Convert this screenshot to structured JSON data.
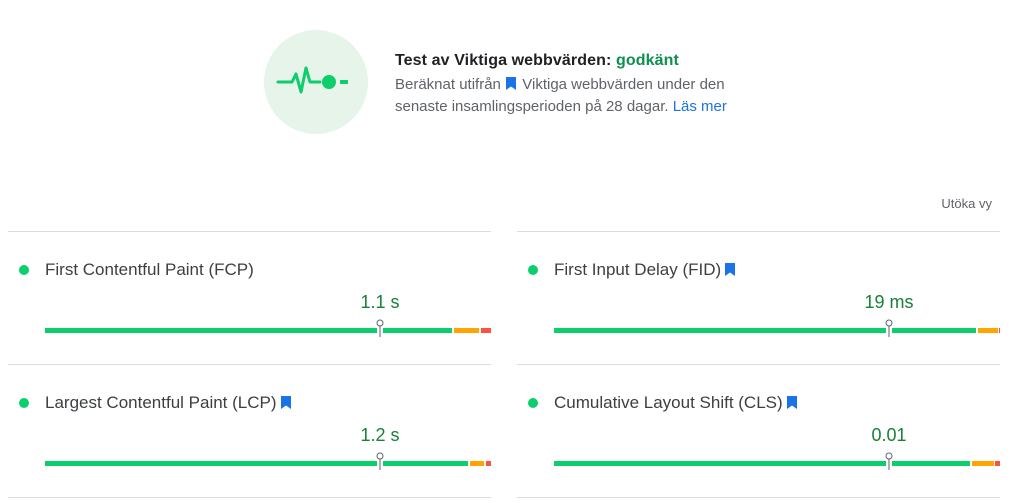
{
  "summary": {
    "title_prefix": "Test av Viktiga webbvärden:",
    "title_status": "godkänt",
    "desc_part1": "Beräknat utifrån",
    "desc_part2": "Viktiga webbvärden under den senaste insamlingsperioden på 28 dagar.",
    "learn_more": "Läs mer"
  },
  "expand_label": "Utöka vy",
  "colors": {
    "good": "#0cce6b",
    "needs_improvement": "#ffa400",
    "poor": "#ff4e42",
    "link": "#1a73e8",
    "bookmark": "#1a73e8"
  },
  "metrics": [
    {
      "name": "First Contentful Paint (FCP)",
      "value": "1.1 s",
      "bookmark": false,
      "good_pct": 0.91,
      "mid_pct": 0.06,
      "poor_pct": 0.03,
      "marker_pct": 0.75
    },
    {
      "name": "First Input Delay (FID)",
      "value": "19 ms",
      "bookmark": true,
      "good_pct": 0.948,
      "mid_pct": 0.047,
      "poor_pct": 0.005,
      "marker_pct": 0.75
    },
    {
      "name": "Largest Contentful Paint (LCP)",
      "value": "1.2 s",
      "bookmark": true,
      "good_pct": 0.948,
      "mid_pct": 0.035,
      "poor_pct": 0.017,
      "marker_pct": 0.75
    },
    {
      "name": "Cumulative Layout Shift (CLS)",
      "value": "0.01",
      "bookmark": true,
      "good_pct": 0.935,
      "mid_pct": 0.052,
      "poor_pct": 0.013,
      "marker_pct": 0.75
    }
  ]
}
